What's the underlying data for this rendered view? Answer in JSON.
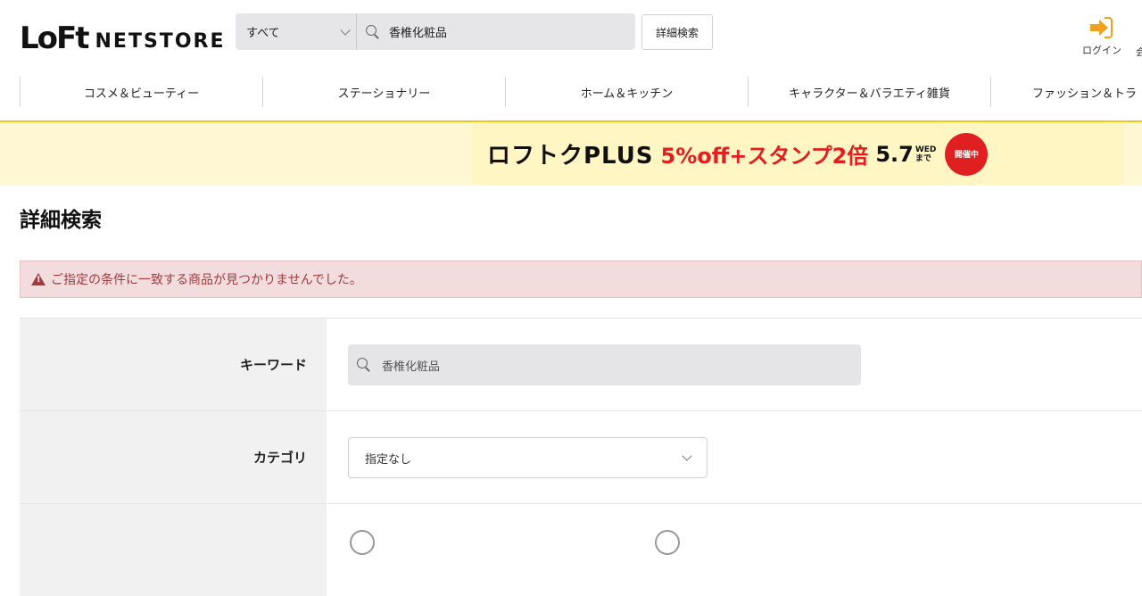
{
  "header": {
    "logo_mark": "LoFt",
    "logo_text": "NETSTORE",
    "search_scope": "すべて",
    "search_query": "香椎化粧品",
    "advanced_search_label": "詳細検索",
    "login_label": "ログイン",
    "member_label_cut": "会"
  },
  "categories": [
    "コスメ＆ビューティー",
    "ステーショナリー",
    "ホーム＆キッチン",
    "キャラクター＆バラエティ雑貨",
    "ファッション＆トラ"
  ],
  "banner": {
    "main": "ロフトクPLUS",
    "offer": "5%off+スタンプ2倍",
    "date": "5.7",
    "day_line1": "WED",
    "day_line2": "まで",
    "badge": "開催中"
  },
  "page": {
    "title": "詳細検索",
    "alert": "ご指定の条件に一致する商品が見つかりませんでした。"
  },
  "form": {
    "keyword_label": "キーワード",
    "keyword_value": "香椎化粧品",
    "category_label": "カテゴリ",
    "category_value": "指定なし"
  },
  "colors": {
    "accent_yellow": "#f5c518",
    "login_orange": "#f0a020",
    "alert_bg": "#f2dcdd",
    "alert_text": "#a23b3f",
    "banner_red": "#e02020"
  }
}
